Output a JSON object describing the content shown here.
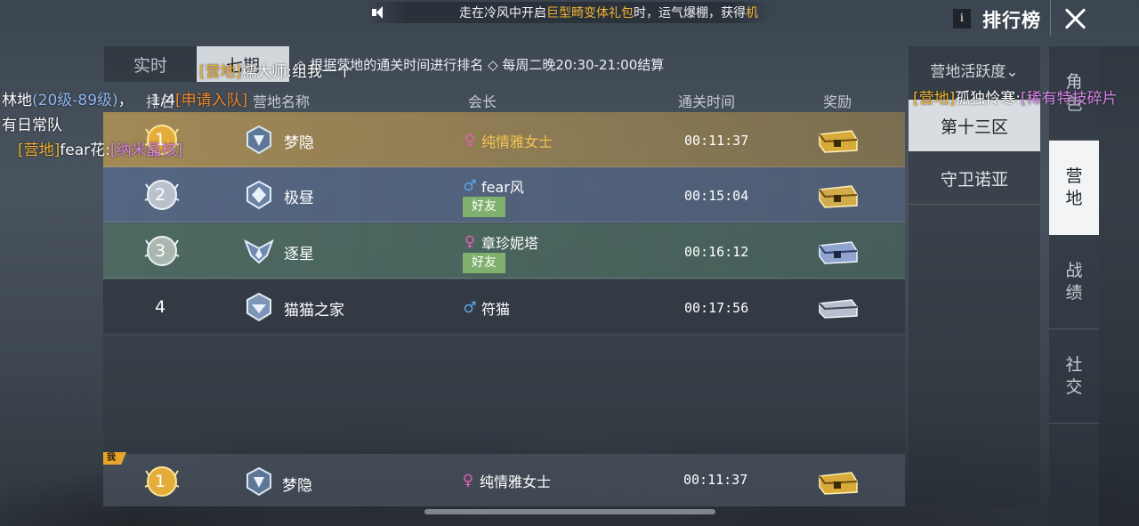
{
  "marquee": {
    "text_before": "走在冷风中开启",
    "highlight": "巨型畸变体礼包",
    "text_after": "时，运气爆棚，获得",
    "tail": "机"
  },
  "header": {
    "info_label": "i",
    "title": "排行榜"
  },
  "period_tabs": [
    {
      "label": "实时"
    },
    {
      "label": "七期"
    }
  ],
  "rule_text": "◇ 根据营地的通关时间进行排名 ◇ 每周二晚20:30-21:00结算",
  "table": {
    "columns": {
      "rank": "排名",
      "camp": "营地名称",
      "leader": "会长",
      "time": "通关时间",
      "reward": "奖励"
    },
    "rows": [
      {
        "rank": "1",
        "camp": "梦隐",
        "gender": "♀",
        "leader": "纯情雅女士",
        "friend": "",
        "time": "00:11:37",
        "reward": "gold-chest-icon"
      },
      {
        "rank": "2",
        "camp": "极昼",
        "gender": "♂",
        "leader": "fear风",
        "friend": "好友",
        "time": "00:15:04",
        "reward": "gold-chest-icon"
      },
      {
        "rank": "3",
        "camp": "逐星",
        "gender": "♀",
        "leader": "章珍妮塔",
        "friend": "好友",
        "time": "00:16:12",
        "reward": "blue-chest-icon"
      },
      {
        "rank": "4",
        "camp": "猫猫之家",
        "gender": "♂",
        "leader": "符猫",
        "friend": "",
        "time": "00:17:56",
        "reward": "silver-chest-icon"
      }
    ],
    "my_row": {
      "tag": "我",
      "rank": "1",
      "camp": "梦隐",
      "gender": "♀",
      "leader": "纯情雅女士",
      "time": "00:11:37",
      "reward": "gold-chest-icon"
    }
  },
  "zones": {
    "filter": "营地活跃度⌄",
    "items": [
      "第十三区",
      "守卫诺亚"
    ]
  },
  "right_nav": [
    {
      "line1": "角",
      "line2": "色"
    },
    {
      "line1": "营",
      "line2": "地"
    },
    {
      "line1": "战",
      "line2": "绩"
    },
    {
      "line1": "社",
      "line2": "交"
    }
  ],
  "chat": {
    "msg1": {
      "tag": "[营地]",
      "name": "糯大师",
      "sep": ":",
      "text": "组我一个"
    },
    "msg2": {
      "prefix": "林地",
      "level": "(20级-89级)",
      "mid": "，",
      "count": "1/4",
      "apply": "[申请入队]"
    },
    "msg3": {
      "text": "有日常队"
    },
    "msg4": {
      "tag": "[营地]",
      "name": "fear花",
      "sep": ":",
      "item": "[纳米晶核]"
    },
    "msg5": {
      "tag": "[营地]",
      "name": "孤独怜寒",
      "sep": ":",
      "item": "[稀有特技碎片"
    }
  },
  "colors": {
    "gold_row": "#b29456",
    "blue_row": "#566886",
    "green_row": "#4e6c62",
    "accent_gold": "#f0b437",
    "female": "#e360b0",
    "male": "#5aa6e8",
    "friend": "#7fb06e"
  }
}
